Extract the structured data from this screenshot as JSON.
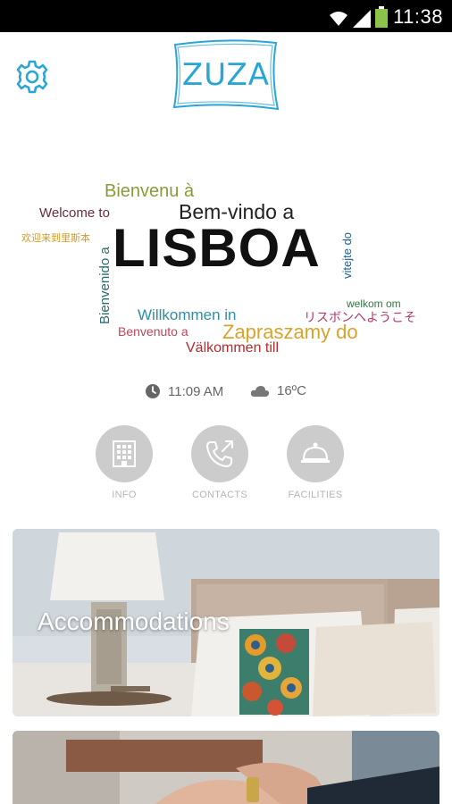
{
  "status_bar": {
    "time": "11:38",
    "icons": [
      "wifi-icon",
      "signal-icon",
      "battery-icon"
    ]
  },
  "header": {
    "logo_text": "ZUZA",
    "settings_icon": "gear-icon"
  },
  "welcome_cloud": {
    "words": [
      "Bienvenu à",
      "Welcome to",
      "Bem-vindo a",
      "欢迎来到里斯本",
      "Bienvenido a",
      "LISBOA",
      "vitejte do",
      "welkom om",
      "Willkommen in",
      "リスボンへようこそ",
      "Benvenuto a",
      "Zapraszamy do",
      "Välkommen till"
    ]
  },
  "info": {
    "time": "11:09 AM",
    "weather": "16ºC",
    "clock_icon": "clock-icon",
    "weather_icon": "cloud-icon"
  },
  "quick_actions": [
    {
      "label": "INFO",
      "icon": "building-icon"
    },
    {
      "label": "CONTACTS",
      "icon": "phone-icon"
    },
    {
      "label": "FACILITIES",
      "icon": "service-bell-icon"
    }
  ],
  "cards": [
    {
      "title": "Accommodations"
    },
    {
      "title": ""
    }
  ],
  "colors": {
    "accent": "#2aa5d8",
    "circle": "#cccccc",
    "label": "#b5b5b5"
  }
}
